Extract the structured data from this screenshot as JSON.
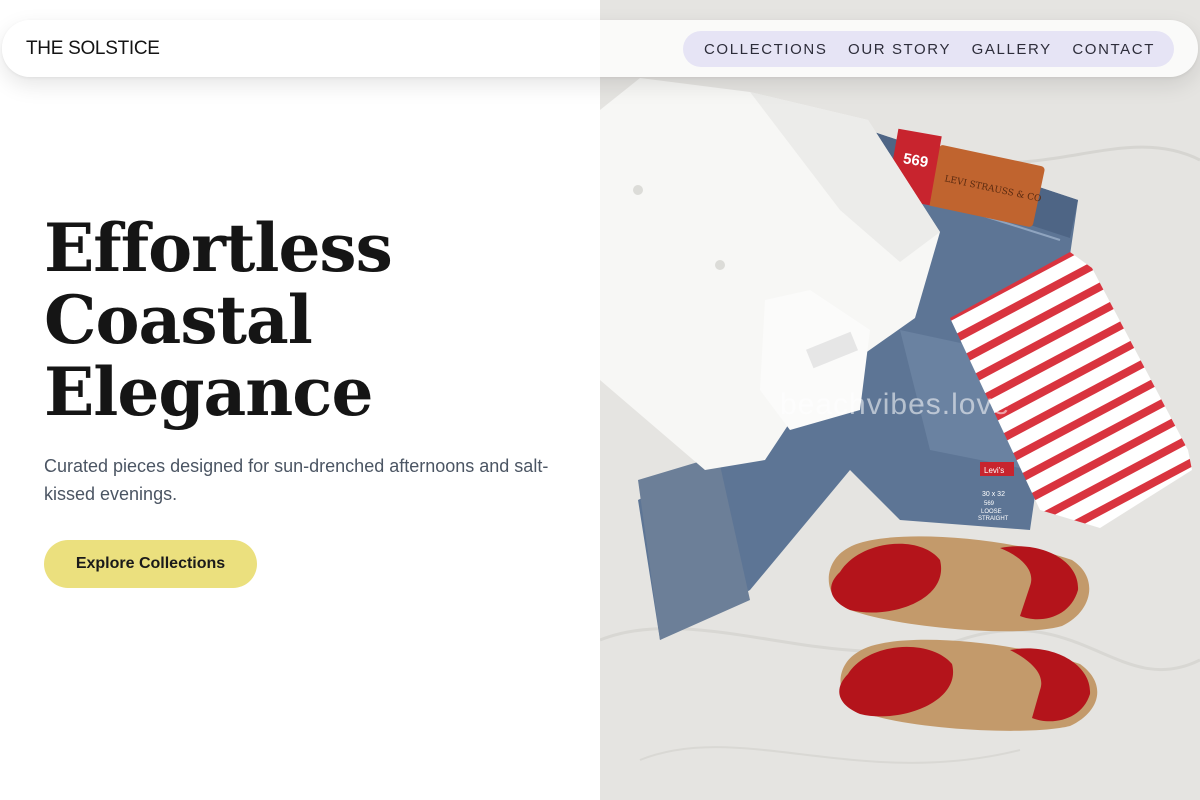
{
  "brand": {
    "name": "THE SOLSTICE"
  },
  "nav": {
    "links": [
      "COLLECTIONS",
      "OUR STORY",
      "GALLERY",
      "CONTACT"
    ]
  },
  "hero": {
    "title_lines": [
      "Effortless",
      "Coastal",
      "Elegance"
    ],
    "subtitle": "Curated pieces designed for sun-drenched afternoons and salt-kissed evenings.",
    "cta_label": "Explore Collections"
  },
  "image": {
    "watermark": "beachvibes.love",
    "label_text": [
      "569",
      "LEVI STRAUSS & CO",
      "Levi's",
      "30 x 32",
      "569",
      "LOOSE",
      "STRAIGHT"
    ]
  },
  "colors": {
    "accent_button": "#ebe07e",
    "nav_pill": "#e6e4f5",
    "title_text": "#151515",
    "subtitle_text": "#4b5563"
  }
}
